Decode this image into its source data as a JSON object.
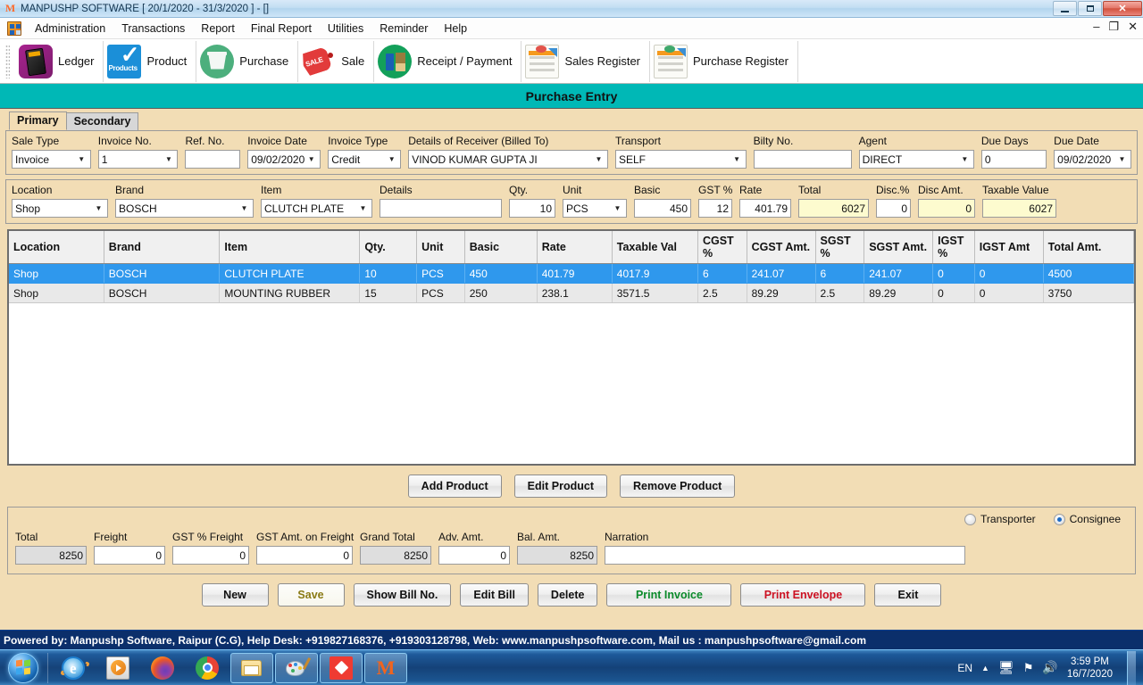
{
  "window": {
    "title": "MANPUSHP SOFTWARE [ 20/1/2020 - 31/3/2020 ]  - []",
    "minimize": "–",
    "restore": "❐",
    "close": "✕",
    "inner_minimize": "–",
    "inner_restore": "❐",
    "inner_close": "✕"
  },
  "menu": {
    "items": [
      {
        "label": "Administration"
      },
      {
        "label": "Transactions"
      },
      {
        "label": "Report"
      },
      {
        "label": "Final Report"
      },
      {
        "label": "Utilities"
      },
      {
        "label": "Reminder"
      },
      {
        "label": "Help"
      }
    ]
  },
  "toolbar": {
    "items": [
      {
        "label": "Ledger",
        "icon": "ledger-book-icon"
      },
      {
        "label": "Product",
        "icon": "product-checkmark-icon"
      },
      {
        "label": "Purchase",
        "icon": "purchase-basket-icon"
      },
      {
        "label": "Sale",
        "icon": "sale-tag-icon"
      },
      {
        "label": "Receipt / Payment",
        "icon": "receipt-payment-icon"
      },
      {
        "label": "Sales Register",
        "icon": "sales-register-document-icon"
      },
      {
        "label": "Purchase Register",
        "icon": "purchase-register-document-icon"
      }
    ]
  },
  "page": {
    "title": "Purchase Entry",
    "accent_teal": "#00b8b6",
    "background_beige": "#f2ddb5"
  },
  "tabs": [
    {
      "label": "Primary",
      "active": true
    },
    {
      "label": "Secondary",
      "active": false
    }
  ],
  "primary_fields": {
    "sale_type": {
      "label": "Sale Type",
      "value": "Invoice"
    },
    "invoice_no": {
      "label": "Invoice No.",
      "value": "1"
    },
    "ref_no": {
      "label": "Ref. No.",
      "value": ""
    },
    "invoice_date": {
      "label": "Invoice Date",
      "value": "09/02/2020"
    },
    "invoice_type": {
      "label": "Invoice Type",
      "value": "Credit"
    },
    "receiver": {
      "label": "Details of Receiver (Billed To)",
      "value": "VINOD KUMAR GUPTA JI"
    },
    "transport": {
      "label": "Transport",
      "value": "SELF"
    },
    "bilty_no": {
      "label": "Bilty No.",
      "value": ""
    },
    "agent": {
      "label": "Agent",
      "value": "DIRECT"
    },
    "due_days": {
      "label": "Due Days",
      "value": "0"
    },
    "due_date": {
      "label": "Due Date",
      "value": "09/02/2020"
    }
  },
  "product_entry": {
    "location": {
      "label": "Location",
      "value": "Shop"
    },
    "brand": {
      "label": "Brand",
      "value": "BOSCH"
    },
    "item": {
      "label": "Item",
      "value": "CLUTCH PLATE"
    },
    "details": {
      "label": "Details",
      "value": ""
    },
    "qty": {
      "label": "Qty.",
      "value": "10"
    },
    "unit": {
      "label": "Unit",
      "value": "PCS"
    },
    "basic": {
      "label": "Basic",
      "value": "450"
    },
    "gst_pct": {
      "label": "GST %",
      "value": "12"
    },
    "rate": {
      "label": "Rate",
      "value": "401.79"
    },
    "total": {
      "label": "Total",
      "value": "6027"
    },
    "disc_pct": {
      "label": "Disc.%",
      "value": "0"
    },
    "disc_amt": {
      "label": "Disc Amt.",
      "value": "0"
    },
    "taxable_value": {
      "label": "Taxable Value",
      "value": "6027"
    }
  },
  "grid": {
    "columns": [
      "Location",
      "Brand",
      "Item",
      "Qty.",
      "Unit",
      "Basic",
      "Rate",
      "Taxable Val",
      "CGST %",
      "CGST Amt.",
      "SGST %",
      "SGST Amt.",
      "IGST %",
      "IGST Amt",
      "Total Amt."
    ],
    "rows": [
      {
        "selected": true,
        "cells": [
          "Shop",
          "BOSCH",
          "CLUTCH PLATE",
          "10",
          "PCS",
          "450",
          "401.79",
          "4017.9",
          "6",
          "241.07",
          "6",
          "241.07",
          "0",
          "0",
          "4500"
        ]
      },
      {
        "selected": false,
        "cells": [
          "Shop",
          "BOSCH",
          "MOUNTING RUBBER",
          "15",
          "PCS",
          "250",
          "238.1",
          "3571.5",
          "2.5",
          "89.29",
          "2.5",
          "89.29",
          "0",
          "0",
          "3750"
        ]
      }
    ]
  },
  "grid_buttons": [
    {
      "label": "Add Product",
      "style": "normal"
    },
    {
      "label": "Edit Product",
      "style": "normal"
    },
    {
      "label": "Remove Product",
      "style": "normal"
    }
  ],
  "totals": {
    "total": {
      "label": "Total",
      "value": "8250"
    },
    "freight": {
      "label": "Freight",
      "value": "0"
    },
    "gst_pct_freight": {
      "label": "GST % Freight",
      "value": "0"
    },
    "gst_amt_freight": {
      "label": "GST Amt. on Freight",
      "value": "0"
    },
    "grand_total": {
      "label": "Grand Total",
      "value": "8250"
    },
    "adv_amt": {
      "label": "Adv. Amt.",
      "value": "0"
    },
    "bal_amt": {
      "label": "Bal. Amt.",
      "value": "8250"
    },
    "narration": {
      "label": "Narration",
      "value": ""
    },
    "radios": [
      {
        "label": "Transporter",
        "selected": false
      },
      {
        "label": "Consignee",
        "selected": true
      }
    ]
  },
  "actions": [
    {
      "label": "New",
      "style": "normal"
    },
    {
      "label": "Save",
      "style": "light"
    },
    {
      "label": "Show Bill No.",
      "style": "normal"
    },
    {
      "label": "Edit Bill",
      "style": "normal"
    },
    {
      "label": "Delete",
      "style": "normal"
    },
    {
      "label": "Print Invoice",
      "style": "green"
    },
    {
      "label": "Print Envelope",
      "style": "red"
    },
    {
      "label": "Exit",
      "style": "normal"
    }
  ],
  "footer": {
    "text": "Powered by: Manpushp Software, Raipur (C.G), Help Desk: +919827168376, +919303128798, Web: www.manpushpsoftware.com,  Mail us :  manpushpsoftware@gmail.com"
  },
  "taskbar": {
    "start": "start-orb-icon",
    "items": [
      {
        "icon": "internet-explorer-icon",
        "open": false
      },
      {
        "icon": "windows-media-player-icon",
        "open": false
      },
      {
        "icon": "firefox-icon",
        "open": false
      },
      {
        "icon": "google-chrome-icon",
        "open": false
      },
      {
        "icon": "file-explorer-icon",
        "open": true
      },
      {
        "icon": "paint-icon",
        "open": true
      },
      {
        "icon": "anydesk-icon",
        "open": true
      },
      {
        "icon": "manpushp-app-icon",
        "open": true
      }
    ],
    "language": "EN",
    "time": "3:59 PM",
    "date": "16/7/2020"
  }
}
